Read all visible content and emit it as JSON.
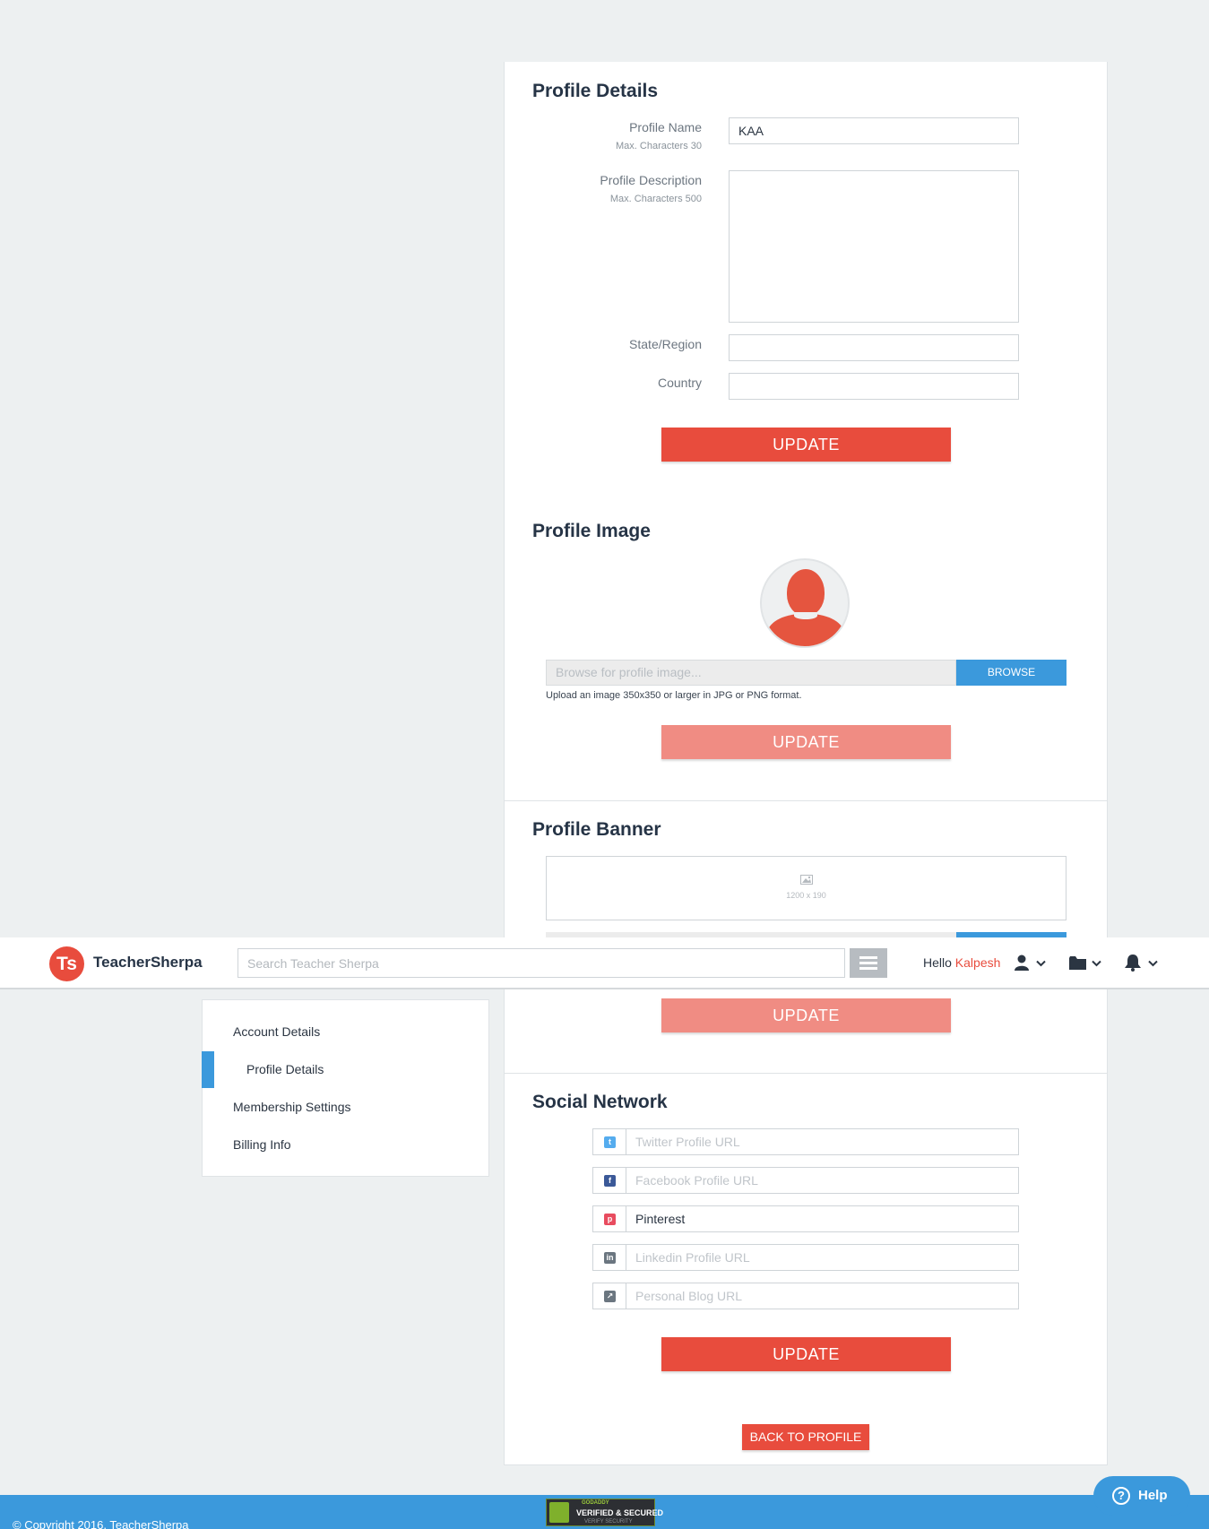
{
  "profile_details": {
    "title": "Profile Details",
    "profile_name_label": "Profile Name",
    "profile_name_hint": "Max. Characters 30",
    "profile_name_value": "KAA",
    "description_label": "Profile Description",
    "description_hint": "Max. Characters 500",
    "description_value": "",
    "state_label": "State/Region",
    "state_value": "",
    "country_label": "Country",
    "country_value": "",
    "update_label": "UPDATE"
  },
  "profile_image": {
    "title": "Profile Image",
    "browse_placeholder": "Browse for profile image...",
    "browse_label": "BROWSE",
    "upload_note": "Upload an image 350x350 or larger in JPG or PNG format.",
    "update_label": "UPDATE"
  },
  "profile_banner": {
    "title": "Profile Banner",
    "size_hint": "1200 x 190",
    "update_label": "UPDATE"
  },
  "header": {
    "logo": "Ts",
    "brand": "TeacherSherpa",
    "search_placeholder": "Search Teacher Sherpa",
    "hello_prefix": "Hello",
    "user_name": "Kalpesh"
  },
  "sidebar": {
    "items": [
      {
        "label": "Account Details"
      },
      {
        "label": "Profile Details"
      },
      {
        "label": "Membership Settings"
      },
      {
        "label": "Billing Info"
      }
    ]
  },
  "social": {
    "title": "Social Network",
    "rows": [
      {
        "icon": "twitter-icon",
        "placeholder": "Twitter Profile URL",
        "value": "",
        "color": "#55acee"
      },
      {
        "icon": "facebook-icon",
        "placeholder": "Facebook Profile URL",
        "value": "",
        "color": "#3b5998"
      },
      {
        "icon": "pinterest-icon",
        "placeholder": "",
        "value": "Pinterest",
        "color": "#e84c5f"
      },
      {
        "icon": "linkedin-icon",
        "placeholder": "Linkedin Profile URL",
        "value": "",
        "color": "#6b7680"
      },
      {
        "icon": "blog-icon",
        "placeholder": "Personal Blog URL",
        "value": "",
        "color": "#6b7680"
      }
    ],
    "update_label": "UPDATE",
    "back_label": "BACK TO PROFILE"
  },
  "footer": {
    "copyright": "© Copyright 2016, TeacherSherpa",
    "seal_top": "GODADDY",
    "seal_main": "VERIFIED & SECURED",
    "seal_bottom": "VERIFY SECURITY",
    "help_label": "Help"
  },
  "colors": {
    "accent_red": "#e84c3d",
    "accent_blue": "#3b99dc",
    "background": "#edf0f1"
  }
}
